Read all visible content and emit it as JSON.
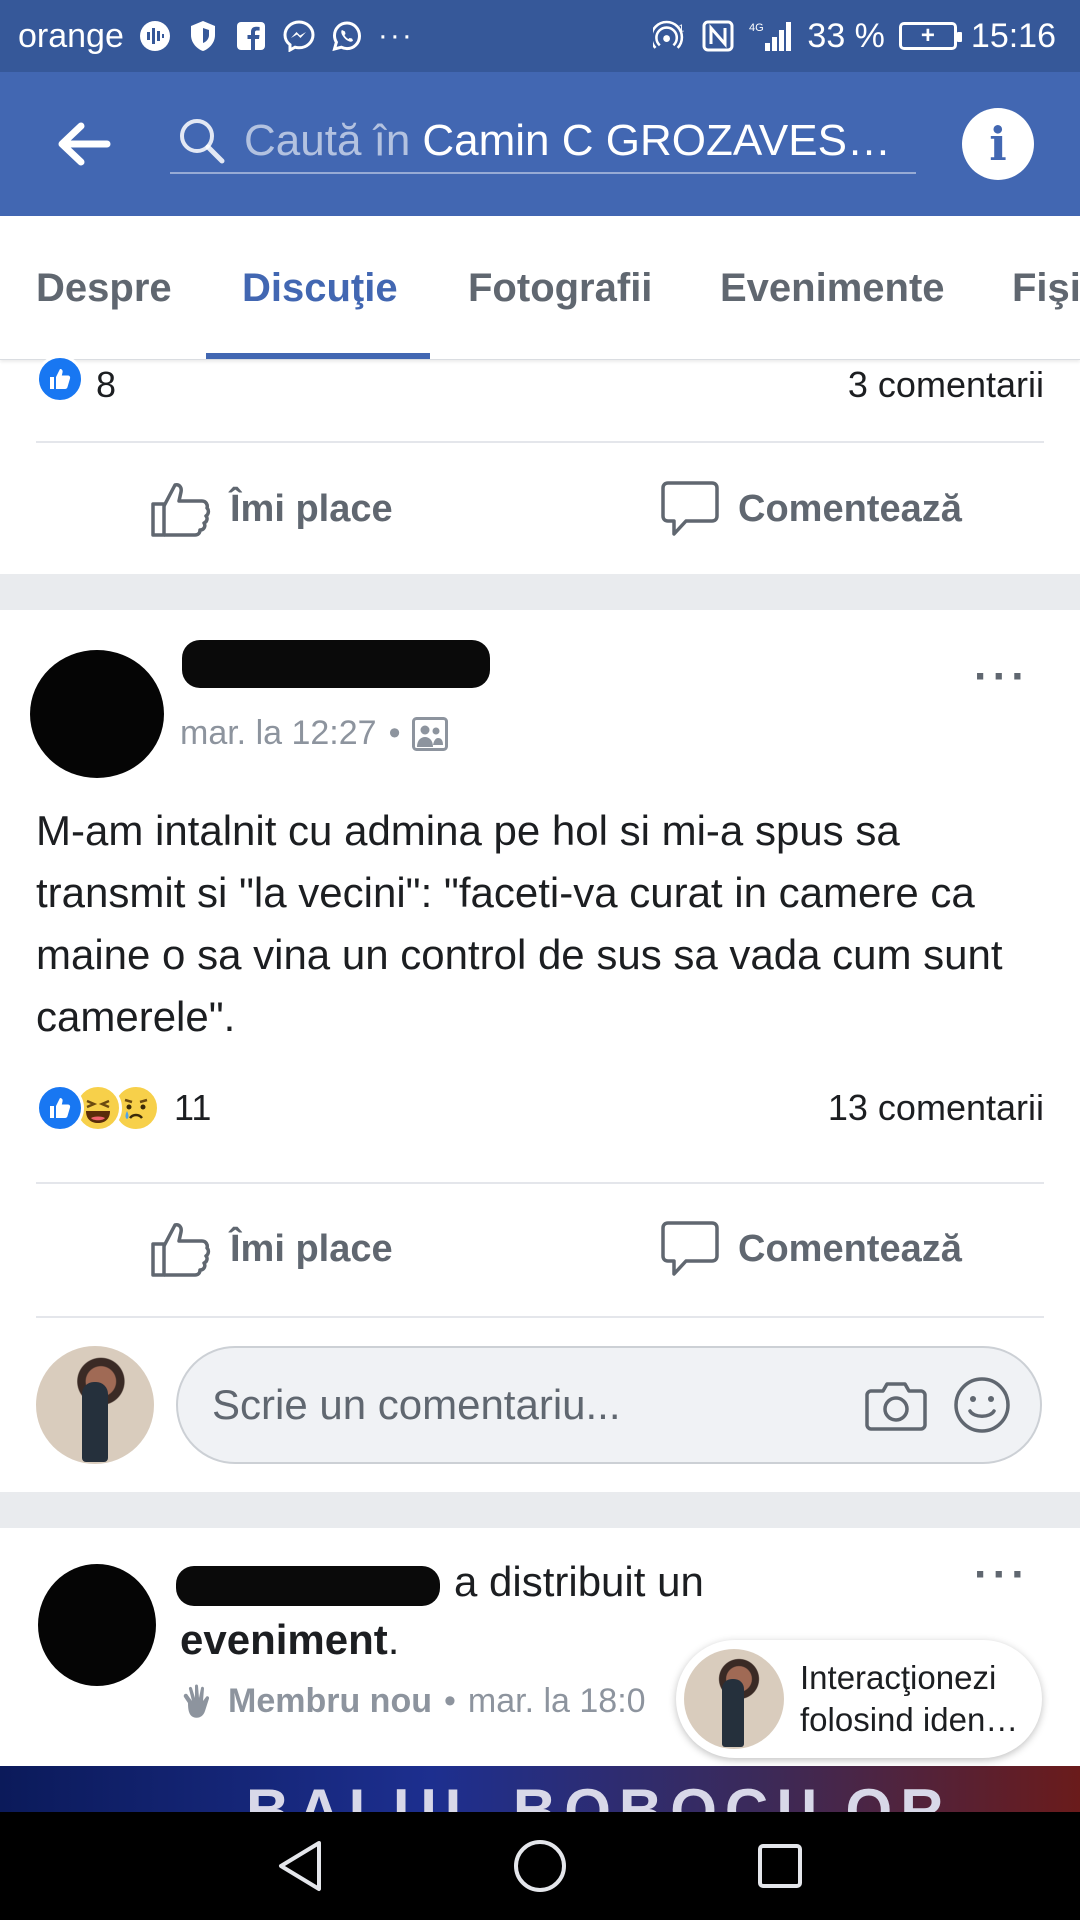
{
  "status_bar": {
    "carrier": "orange",
    "signal_label": "4G",
    "battery_percent": "33 %",
    "time": "15:16"
  },
  "app_bar": {
    "search_placeholder": "Caută în",
    "search_query": "Camin C GROZAVES…"
  },
  "tabs": [
    {
      "label": "Despre"
    },
    {
      "label": "Discuţie"
    },
    {
      "label": "Fotografii"
    },
    {
      "label": "Evenimente"
    },
    {
      "label": "Fişi"
    }
  ],
  "active_tab": "Discuţie",
  "post_prev": {
    "reaction_count": "8",
    "comments": "3 comentarii",
    "like_label": "Îmi place",
    "comment_label": "Comentează"
  },
  "post_main": {
    "time": "mar. la 12:27",
    "separator": "•",
    "text": "M-am intalnit cu admina pe hol si mi-a spus sa transmit si \"la vecini\": \"faceti-va curat in camere ca maine o sa vina un control de sus sa vada cum sunt camerele\".",
    "reaction_count": "11",
    "comments": "13 comentarii",
    "like_label": "Îmi place",
    "comment_label": "Comentează",
    "comment_placeholder": "Scrie un comentariu..."
  },
  "post_next": {
    "shared_text": "a distribuit un",
    "object": "eveniment",
    "period": ".",
    "badge": "Membru nou",
    "separator": "•",
    "time": "mar. la 18:0",
    "banner_text": "BALUL BOBOCILOR"
  },
  "identity_chip": {
    "line1": "Interacţionezi",
    "line2": "folosind iden…"
  },
  "colors": {
    "facebook_blue": "#4267b2",
    "status_bar": "#365899",
    "like_blue": "#1877f2"
  }
}
